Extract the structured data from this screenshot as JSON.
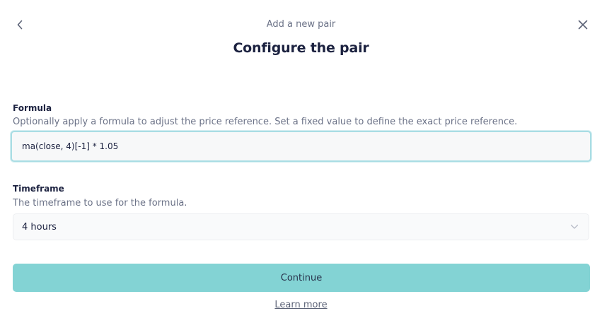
{
  "header": {
    "subtitle": "Add a new pair",
    "title": "Configure the pair",
    "back_icon": "chevron-left-icon",
    "close_icon": "close-icon"
  },
  "formula": {
    "label": "Formula",
    "help": "Optionally apply a formula to adjust the price reference. Set a fixed value to define the exact price reference.",
    "value": "ma(close, 4)[-1] * 1.05"
  },
  "timeframe": {
    "label": "Timeframe",
    "help": "The timeframe to use for the formula.",
    "selected": "4 hours",
    "icon": "chevron-down-icon"
  },
  "actions": {
    "continue_label": "Continue",
    "learn_more_label": "Learn more"
  },
  "colors": {
    "accent": "#83d3d4",
    "focus_border": "#a9dde4",
    "text_primary": "#1c2240",
    "text_muted": "#6b7287"
  }
}
